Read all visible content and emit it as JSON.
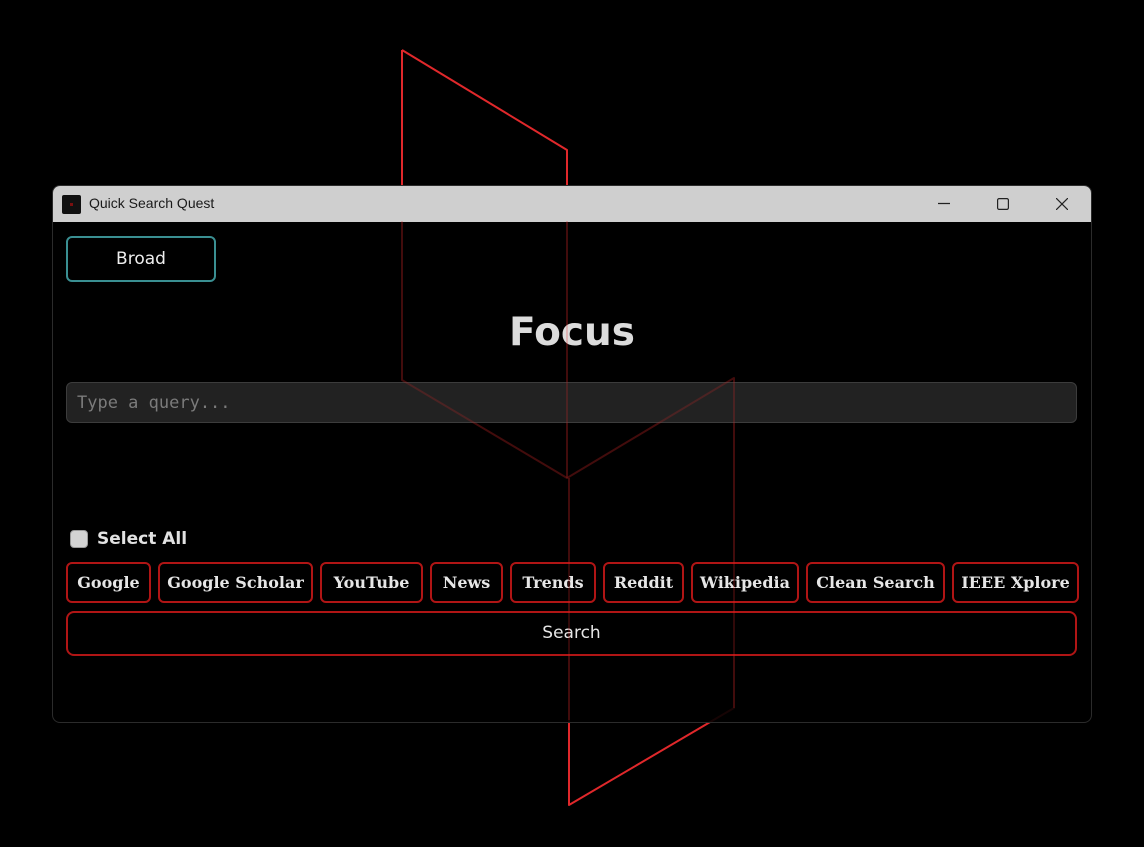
{
  "window": {
    "title": "Quick Search Quest",
    "icon": "app-icon",
    "controls": [
      "minimize-icon",
      "maximize-icon",
      "close-icon"
    ]
  },
  "mode_button": {
    "label": "Broad"
  },
  "heading": "Focus",
  "query": {
    "value": "",
    "placeholder": "Type a query..."
  },
  "select_all": {
    "label": "Select All",
    "checked": false
  },
  "engines": [
    {
      "label": "Google"
    },
    {
      "label": "Google Scholar"
    },
    {
      "label": "YouTube"
    },
    {
      "label": "News"
    },
    {
      "label": "Trends"
    },
    {
      "label": "Reddit"
    },
    {
      "label": "Wikipedia"
    },
    {
      "label": "Clean Search"
    },
    {
      "label": "IEEE Xplore"
    }
  ],
  "search_button": {
    "label": "Search"
  },
  "colors": {
    "background": "#000000",
    "titlebar": "#cfcfcf",
    "accent_teal": "#3a8f92",
    "accent_red": "#b01515",
    "backdrop_line": "#e0282b"
  }
}
